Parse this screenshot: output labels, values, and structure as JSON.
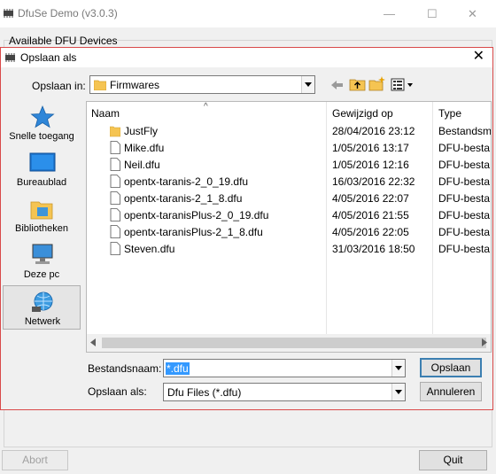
{
  "app": {
    "title": "DfuSe Demo (v3.0.3)",
    "group_label": "Available DFU Devices",
    "abort_label": "Abort",
    "quit_label": "Quit",
    "minimize_glyph": "—",
    "maximize_glyph": "☐",
    "close_glyph": "✕"
  },
  "dialog": {
    "title": "Opslaan als",
    "close_glyph": "✕",
    "save_in_label": "Opslaan in:",
    "save_in_value": "Firmwares",
    "places": [
      {
        "label": "Snelle toegang",
        "icon": "star-icon"
      },
      {
        "label": "Bureaublad",
        "icon": "desktop-icon"
      },
      {
        "label": "Bibliotheken",
        "icon": "libraries-icon"
      },
      {
        "label": "Deze pc",
        "icon": "computer-icon"
      },
      {
        "label": "Netwerk",
        "icon": "network-icon"
      }
    ],
    "columns": {
      "name": "Naam",
      "modified": "Gewijzigd op",
      "type": "Type"
    },
    "files": [
      {
        "name": "JustFly",
        "modified": "28/04/2016 23:12",
        "type": "Bestandsm",
        "kind": "folder"
      },
      {
        "name": "Mike.dfu",
        "modified": "1/05/2016 13:17",
        "type": "DFU-besta",
        "kind": "file"
      },
      {
        "name": "Neil.dfu",
        "modified": "1/05/2016 12:16",
        "type": "DFU-besta",
        "kind": "file"
      },
      {
        "name": "opentx-taranis-2_0_19.dfu",
        "modified": "16/03/2016 22:32",
        "type": "DFU-besta",
        "kind": "file"
      },
      {
        "name": "opentx-taranis-2_1_8.dfu",
        "modified": "4/05/2016 22:07",
        "type": "DFU-besta",
        "kind": "file"
      },
      {
        "name": "opentx-taranisPlus-2_0_19.dfu",
        "modified": "4/05/2016 21:55",
        "type": "DFU-besta",
        "kind": "file"
      },
      {
        "name": "opentx-taranisPlus-2_1_8.dfu",
        "modified": "4/05/2016 22:05",
        "type": "DFU-besta",
        "kind": "file"
      },
      {
        "name": "Steven.dfu",
        "modified": "31/03/2016 18:50",
        "type": "DFU-besta",
        "kind": "file"
      }
    ],
    "filename_label": "Bestandsnaam:",
    "filename_value": "*.dfu",
    "save_type_label": "Opslaan als:",
    "save_type_value": "Dfu Files (*.dfu)",
    "save_button": "Opslaan",
    "cancel_button": "Annuleren"
  },
  "colors": {
    "accent": "#3399ff",
    "dialog_border": "#d94a4a",
    "folder": "#f5c452"
  }
}
